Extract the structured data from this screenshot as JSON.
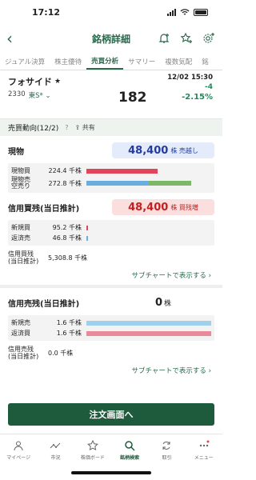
{
  "status": {
    "time": "17:12"
  },
  "nav": {
    "title": "銘柄詳細"
  },
  "tabs": [
    "ジュアル決算",
    "株主優待",
    "売買分析",
    "サマリー",
    "複数気配",
    "銘"
  ],
  "quote": {
    "name": "フォサイド",
    "code": "2330",
    "market": "東S*",
    "price": "182",
    "time": "12/02 15:30",
    "change": "-4",
    "change_pct": "-2.15%"
  },
  "trend": {
    "title": "売買動向(12/2)",
    "help": "?",
    "share": "共有"
  },
  "spot": {
    "label": "現物",
    "value": "48,400",
    "unit": "株 売越し",
    "rows": [
      {
        "label": "現物買",
        "value": "224.4 千株",
        "fill": 0.57
      },
      {
        "label": "現物売\n空売り",
        "value": "272.8 千株",
        "fill": 0.5,
        "fill2": 0.34
      }
    ]
  },
  "margin_buy": {
    "label": "信用買残(当日推計)",
    "value": "48,400",
    "unit": "株 買残増",
    "rows": [
      {
        "label": "新規買",
        "value": "95.2 千株",
        "fill": 0.01
      },
      {
        "label": "返済売",
        "value": "46.8 千株",
        "fill": 0.005
      }
    ],
    "total": {
      "label": "信用買残\n(当日推計)",
      "value": "5,308.8 千株",
      "fill": 0.88
    },
    "link": "サブチャートで表示する ›"
  },
  "margin_sell": {
    "label": "信用売残(当日推計)",
    "value": "0",
    "unit": "株",
    "rows": [
      {
        "label": "新規売",
        "value": "1.6 千株",
        "fill": 1.0
      },
      {
        "label": "返済買",
        "value": "1.6 千株",
        "fill": 1.0
      }
    ],
    "total": {
      "label": "信用売残\n(当日推計)",
      "value": "0.0 千株",
      "fill": 0
    },
    "link": "サブチャートで表示する ›"
  },
  "order_button": "注文画面へ",
  "tabbar": [
    {
      "label": "マイページ",
      "icon": "person-icon"
    },
    {
      "label": "市況",
      "icon": "market-icon"
    },
    {
      "label": "株価ボード",
      "icon": "star-icon"
    },
    {
      "label": "銘柄検索",
      "icon": "search-icon",
      "active": true
    },
    {
      "label": "取引",
      "icon": "trade-icon"
    },
    {
      "label": "メニュー",
      "icon": "menu-icon"
    }
  ],
  "colors": {
    "accent": "#2a6a4c",
    "buy_bar": "#e0465a",
    "sell_bar_blue": "#6aaee0",
    "sell_bar_green": "#7bb86a",
    "margin_buy_bar": "#e88a9a",
    "margin_sell_bar": "#9fd1ec",
    "total_bar": "#7fbfa5"
  }
}
